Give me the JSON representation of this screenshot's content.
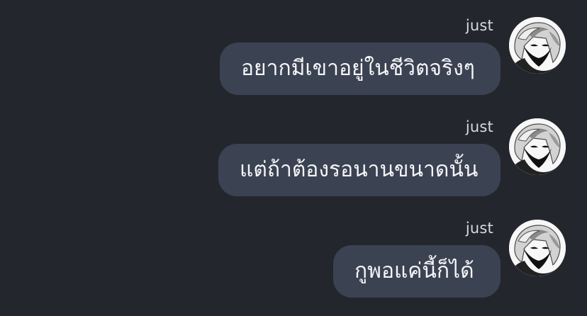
{
  "messages": [
    {
      "sender": "just",
      "text": "อยากมีเขาอยู่ในชีวิตจริงๆ",
      "avatar_icon": "anime-character-avatar-icon"
    },
    {
      "sender": "just",
      "text": "แต่ถ้าต้องรอนานขนาดนั้น",
      "avatar_icon": "anime-character-avatar-icon"
    },
    {
      "sender": "just",
      "text": "กูพอแค่นี้ก็ได้",
      "avatar_icon": "anime-character-avatar-icon"
    }
  ],
  "colors": {
    "background": "#23262d",
    "bubble": "#3b4252",
    "text": "#f4f5f7",
    "sender": "#d7d9de"
  }
}
